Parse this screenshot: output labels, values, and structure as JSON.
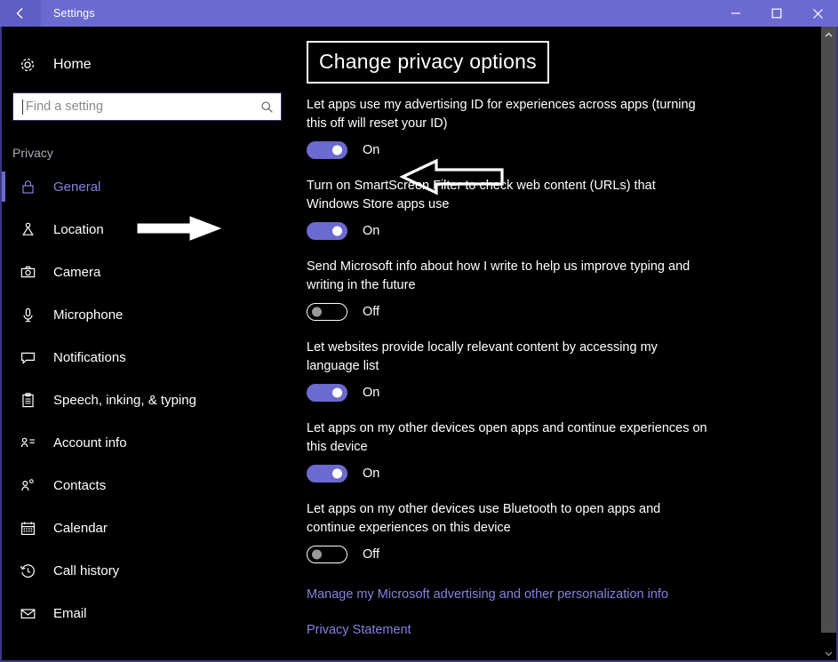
{
  "window": {
    "title": "Settings",
    "back_icon": "back-arrow-icon",
    "minimize_icon": "minimize-icon",
    "maximize_icon": "maximize-icon",
    "close_icon": "close-icon",
    "titlebar_color": "#6b6ad0",
    "background_color": "#000000",
    "accent_color": "#6b6ad0",
    "link_color": "#8482e0"
  },
  "sidebar": {
    "home": {
      "label": "Home",
      "icon": "gear-icon"
    },
    "search": {
      "value": "",
      "placeholder": "Find a setting",
      "icon": "search-icon"
    },
    "section_label": "Privacy",
    "items": [
      {
        "label": "General",
        "icon": "lock-icon",
        "selected": true
      },
      {
        "label": "Location",
        "icon": "location-pin-icon",
        "selected": false
      },
      {
        "label": "Camera",
        "icon": "camera-icon",
        "selected": false
      },
      {
        "label": "Microphone",
        "icon": "microphone-icon",
        "selected": false
      },
      {
        "label": "Notifications",
        "icon": "speech-bubble-icon",
        "selected": false
      },
      {
        "label": "Speech, inking, & typing",
        "icon": "clipboard-icon",
        "selected": false
      },
      {
        "label": "Account info",
        "icon": "account-info-icon",
        "selected": false
      },
      {
        "label": "Contacts",
        "icon": "contacts-icon",
        "selected": false
      },
      {
        "label": "Calendar",
        "icon": "calendar-icon",
        "selected": false
      },
      {
        "label": "Call history",
        "icon": "clock-history-icon",
        "selected": false
      },
      {
        "label": "Email",
        "icon": "envelope-icon",
        "selected": false
      }
    ]
  },
  "main": {
    "heading": "Change privacy options",
    "settings": [
      {
        "description": "Let apps use my advertising ID for experiences across apps (turning this off will reset your ID)",
        "state": "On",
        "on": true
      },
      {
        "description": "Turn on SmartScreen Filter to check web content (URLs) that Windows Store apps use",
        "state": "On",
        "on": true
      },
      {
        "description": "Send Microsoft info about how I write to help us improve typing and writing in the future",
        "state": "Off",
        "on": false
      },
      {
        "description": "Let websites provide locally relevant content by accessing my language list",
        "state": "On",
        "on": true
      },
      {
        "description": "Let apps on my other devices open apps and continue experiences on this device",
        "state": "On",
        "on": true
      },
      {
        "description": "Let apps on my other devices use Bluetooth to open apps and continue experiences on this device",
        "state": "Off",
        "on": false
      }
    ],
    "links": [
      "Manage my Microsoft advertising and other personalization info",
      "Privacy Statement"
    ]
  },
  "annotations": [
    {
      "name": "arrow-pointing-to-general",
      "direction": "right"
    },
    {
      "name": "arrow-pointing-to-advertising-toggle",
      "direction": "left"
    },
    {
      "name": "heading-highlight-box",
      "shape": "rectangle"
    }
  ],
  "scrollbar": {
    "up_arrow_icon": "chevron-up-icon",
    "down_arrow_icon": "chevron-down-icon"
  }
}
